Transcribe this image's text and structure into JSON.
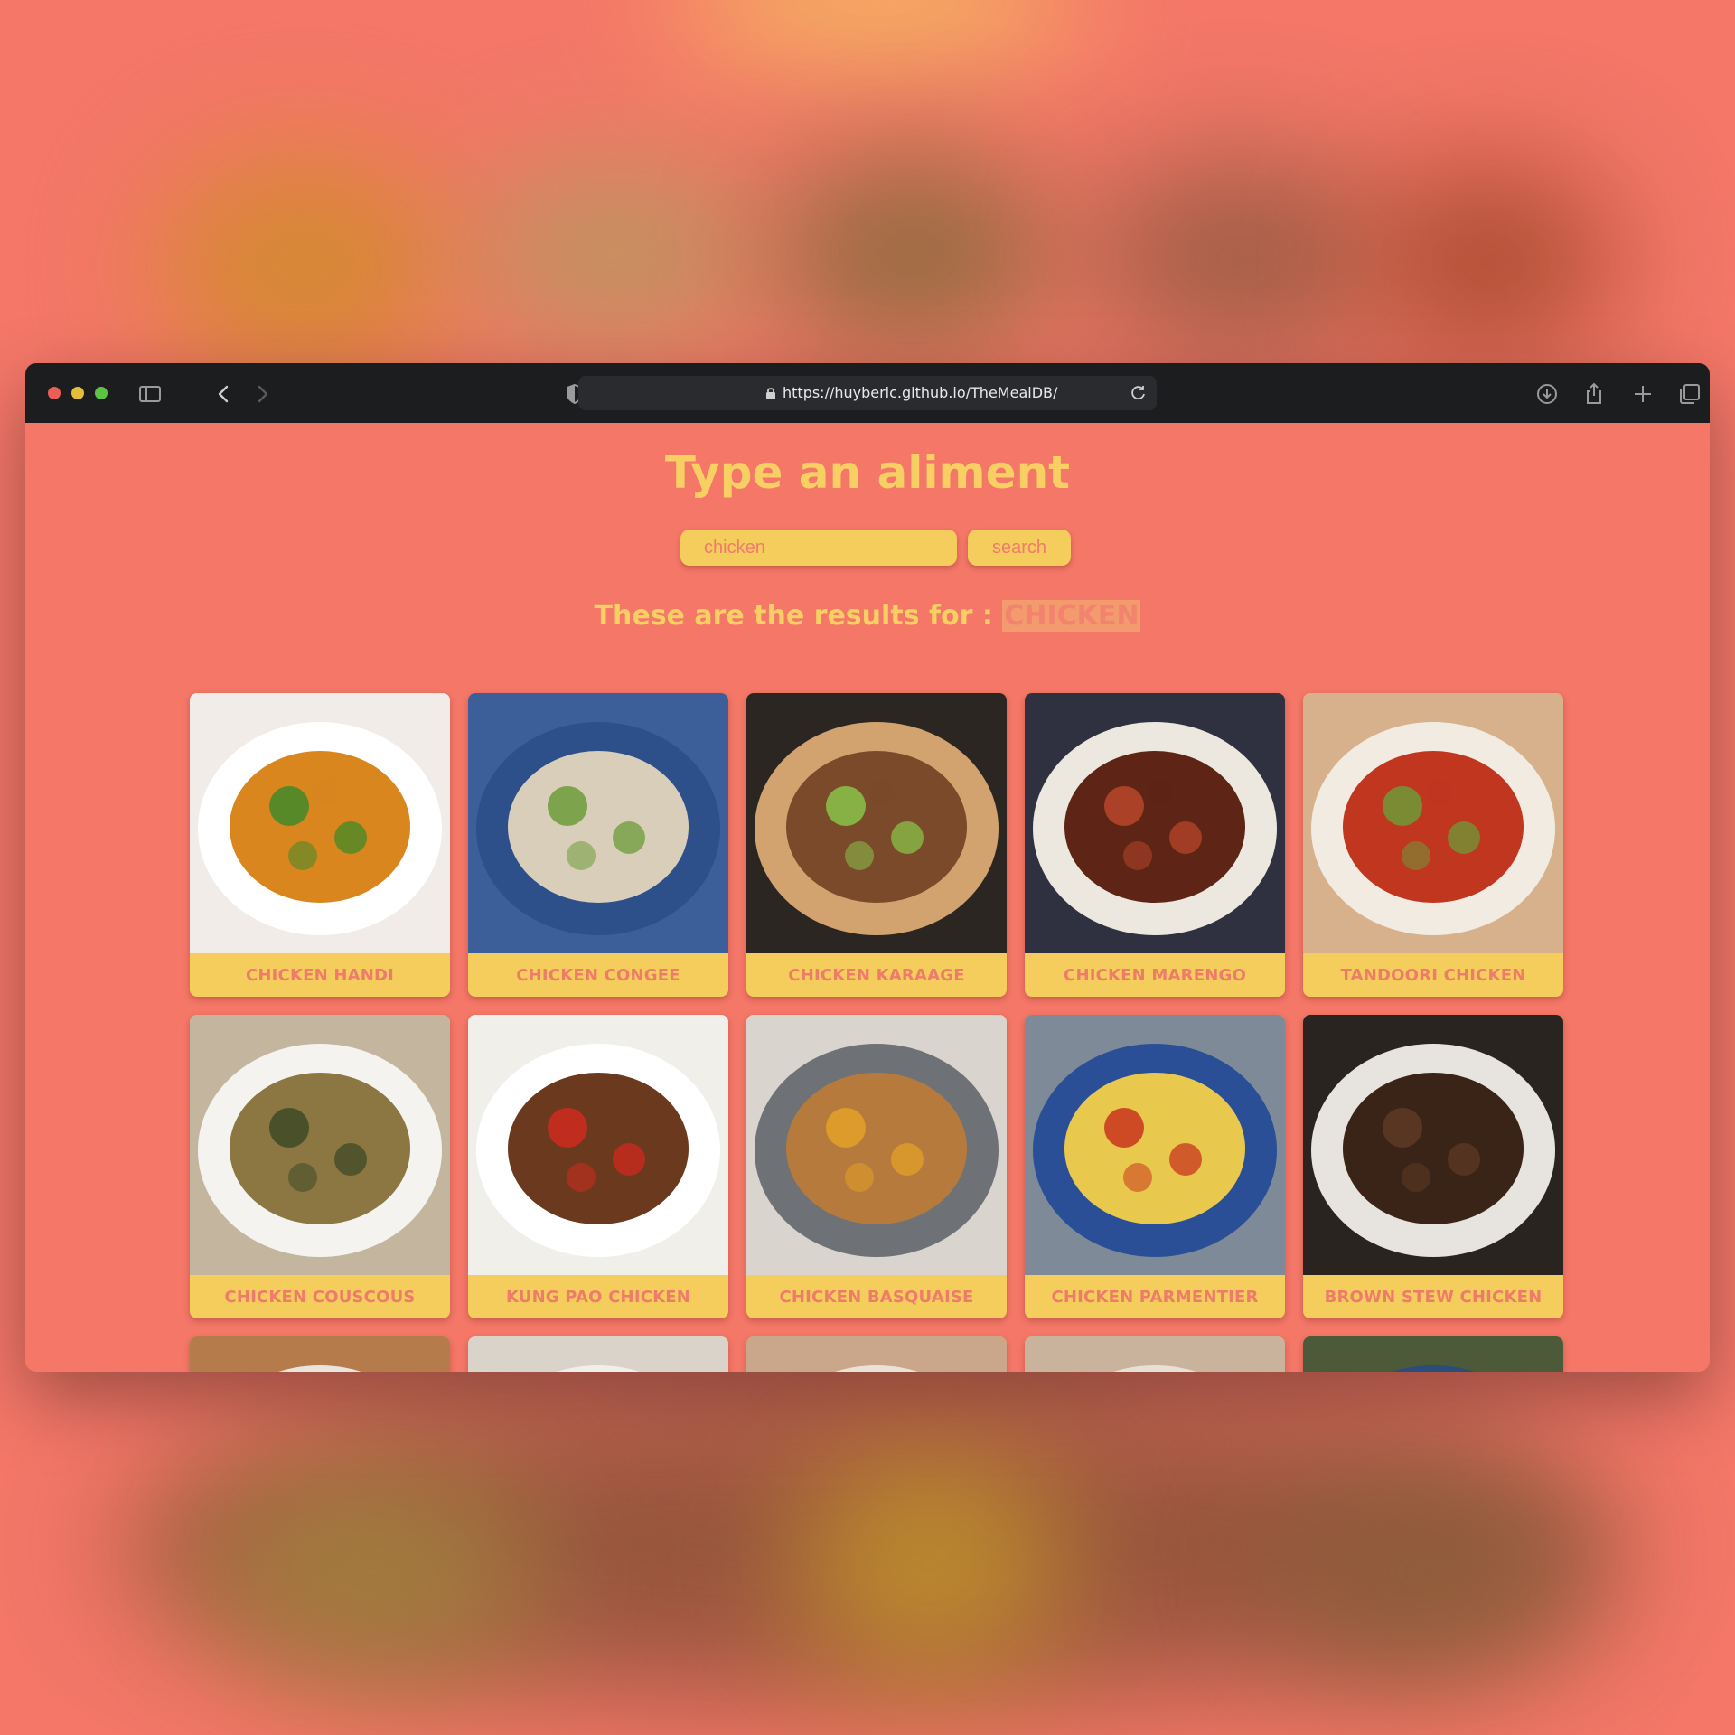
{
  "browser": {
    "url": "https://huyberic.github.io/TheMealDB/"
  },
  "page": {
    "title": "Type an aliment",
    "search": {
      "value": "chicken",
      "button_label": "search"
    },
    "results_prefix": "These are the results for : ",
    "results_term": "CHICKEN"
  },
  "meals": [
    {
      "name": "CHICKEN HANDI",
      "photo": {
        "bg": "#f1ece8",
        "plate": "#ffffff",
        "food": "#d9861f",
        "accent": "#3f8a2a"
      }
    },
    {
      "name": "CHICKEN CONGEE",
      "photo": {
        "bg": "#3c5f9a",
        "plate": "#2d4f8a",
        "food": "#d8ceb9",
        "accent": "#6d9b3a"
      }
    },
    {
      "name": "CHICKEN KARAAGE",
      "photo": {
        "bg": "#2b2622",
        "plate": "#d2a36e",
        "food": "#7a4a2a",
        "accent": "#8ac24a"
      }
    },
    {
      "name": "CHICKEN MARENGO",
      "photo": {
        "bg": "#2f3140",
        "plate": "#ece8e0",
        "food": "#5e2416",
        "accent": "#b8462a"
      }
    },
    {
      "name": "TANDOORI CHICKEN",
      "photo": {
        "bg": "#d7b08c",
        "plate": "#f2ebe2",
        "food": "#c0361f",
        "accent": "#6d9a38"
      }
    },
    {
      "name": "CHICKEN COUSCOUS",
      "photo": {
        "bg": "#c4b59e",
        "plate": "#f5f3ef",
        "food": "#8c7642",
        "accent": "#3d4a26"
      }
    },
    {
      "name": "KUNG PAO CHICKEN",
      "photo": {
        "bg": "#f1efea",
        "plate": "#ffffff",
        "food": "#6b3a1e",
        "accent": "#cf2a1f"
      }
    },
    {
      "name": "CHICKEN BASQUAISE",
      "photo": {
        "bg": "#d9d4cd",
        "plate": "#6e7176",
        "food": "#b67a3c",
        "accent": "#e3a127"
      }
    },
    {
      "name": "CHICKEN PARMENTIER",
      "photo": {
        "bg": "#7e8a97",
        "plate": "#2a4f96",
        "food": "#e9c94d",
        "accent": "#c8341f"
      }
    },
    {
      "name": "BROWN STEW CHICKEN",
      "photo": {
        "bg": "#2a2420",
        "plate": "#e7e3de",
        "food": "#3a2418",
        "accent": "#5e3a24"
      }
    }
  ],
  "peek_row": [
    {
      "photo": {
        "bg": "#b67b4a",
        "plate": "#e9e4dc",
        "food": "#a04a26",
        "accent": "#4c6e9b"
      }
    },
    {
      "photo": {
        "bg": "#d9d3ca",
        "plate": "#f2efe9",
        "food": "#8a5a34",
        "accent": "#b8843c"
      }
    },
    {
      "photo": {
        "bg": "#caa78b",
        "plate": "#eae2d6",
        "food": "#c06426",
        "accent": "#c07a34"
      }
    },
    {
      "photo": {
        "bg": "#c9b39d",
        "plate": "#e8e0d4",
        "food": "#c2682e",
        "accent": "#b85a2a"
      }
    },
    {
      "photo": {
        "bg": "#4d5a3a",
        "plate": "#2a4d7a",
        "food": "#5f7a3a",
        "accent": "#3a5f88"
      }
    }
  ]
}
